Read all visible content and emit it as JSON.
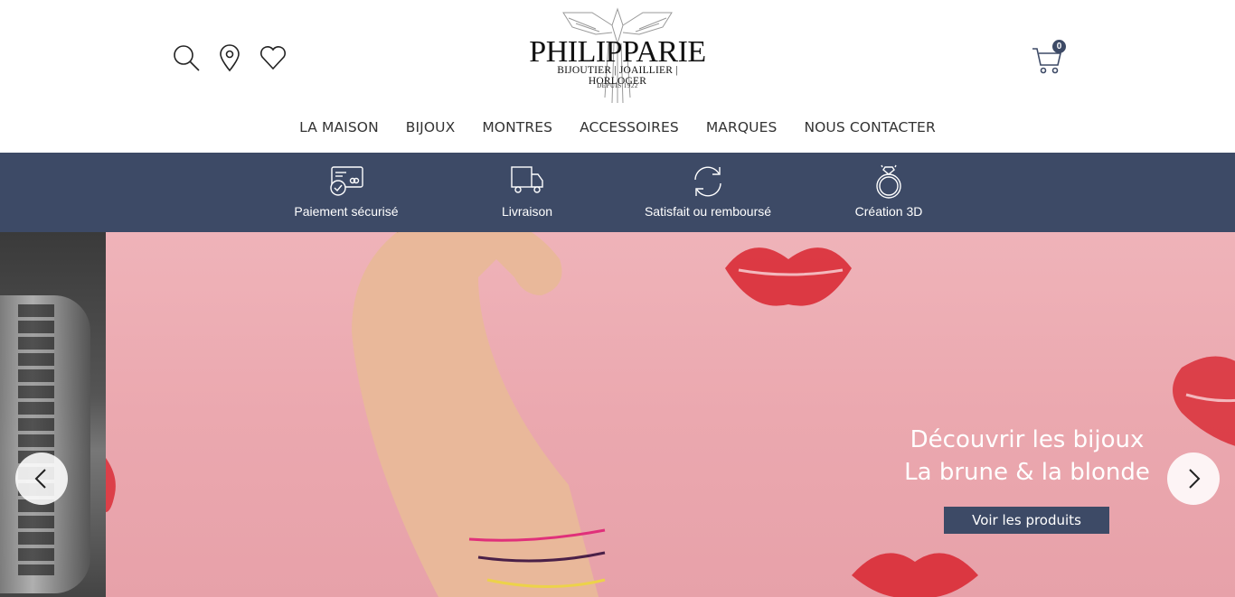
{
  "header": {
    "icons": [
      "search-icon",
      "location-pin-icon",
      "heart-icon"
    ],
    "logo": {
      "name": "PHILIPPARIE",
      "subtitle": "BIJOUTIER | JOAILLIER | HORLOGER",
      "since": "DEPUIS 1922"
    },
    "cart": {
      "icon": "cart-icon",
      "count": "0"
    }
  },
  "nav": {
    "items": [
      {
        "label": "LA MAISON"
      },
      {
        "label": "BIJOUX"
      },
      {
        "label": "MONTRES"
      },
      {
        "label": "ACCESSOIRES"
      },
      {
        "label": "MARQUES"
      },
      {
        "label": "NOUS CONTACTER"
      }
    ]
  },
  "reassurance": {
    "items": [
      {
        "icon": "credit-card-icon",
        "label": "Paiement sécurisé"
      },
      {
        "icon": "truck-icon",
        "label": "Livraison"
      },
      {
        "icon": "refresh-icon",
        "label": "Satisfait ou remboursé"
      },
      {
        "icon": "ring-icon",
        "label": "Création 3D"
      }
    ]
  },
  "slider": {
    "title_line1": "Découvrir les bijoux",
    "title_line2": "La brune & la blonde",
    "button_label": "Voir les produits",
    "prev_icon": "chevron-left-icon",
    "next_icon": "chevron-right-icon"
  },
  "colors": {
    "brand_navy": "#3d4a66",
    "slide_pink": "#eba7ae"
  }
}
